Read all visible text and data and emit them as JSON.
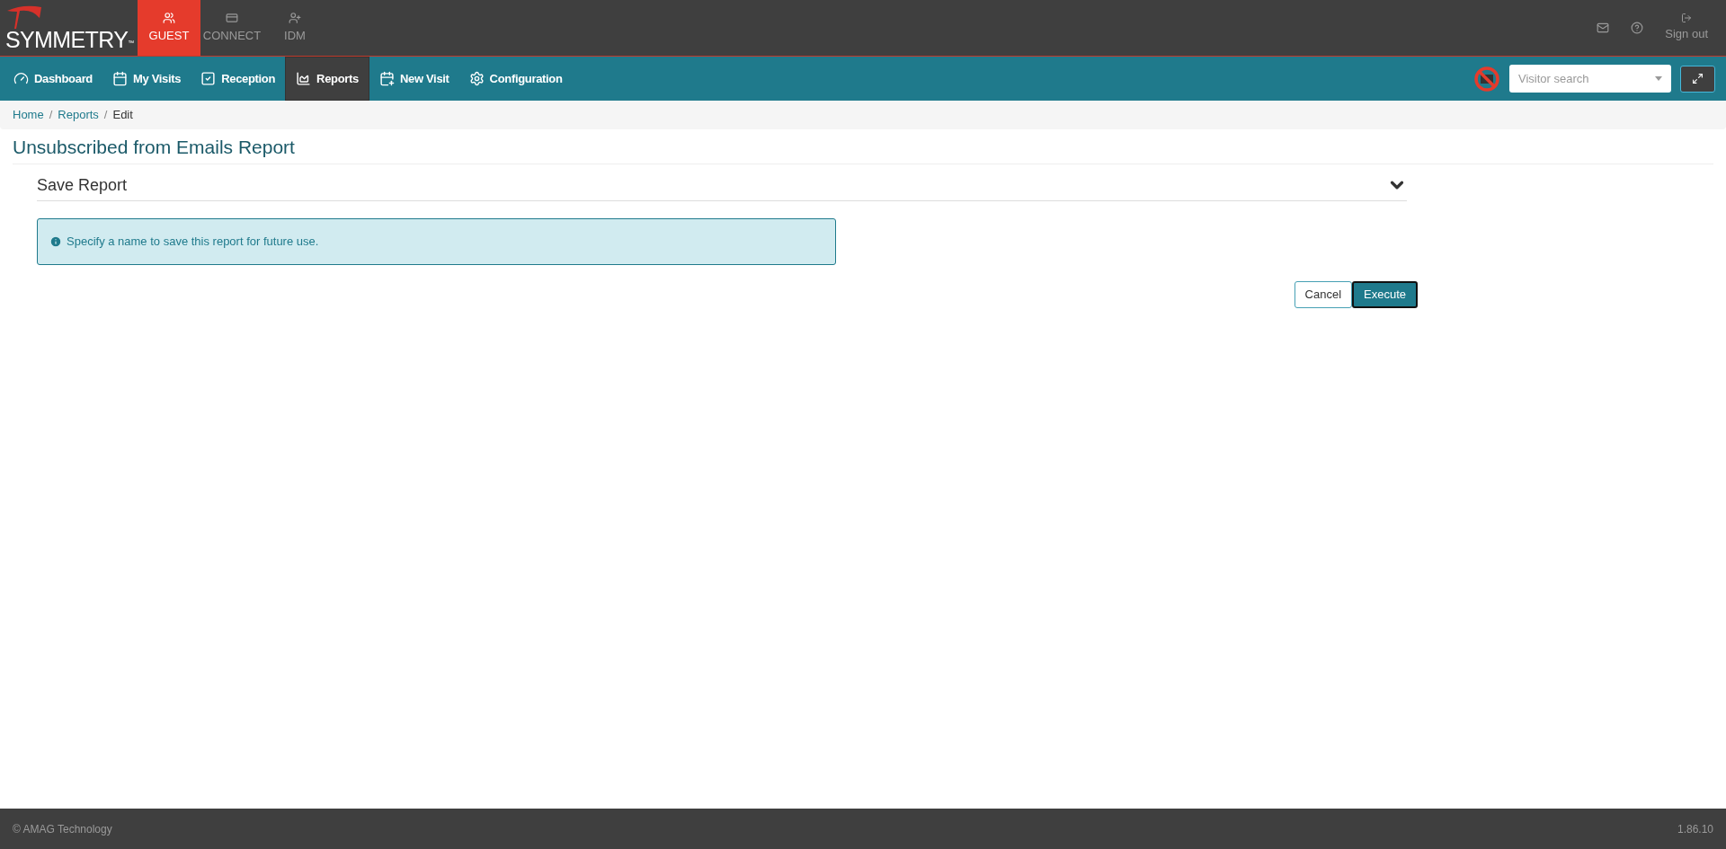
{
  "logo": {
    "text": "SYMMETRY",
    "mark": "™"
  },
  "apps": [
    {
      "label": "GUEST",
      "kind": "guest",
      "selected": true
    },
    {
      "label": "CONNECT",
      "kind": "connect",
      "selected": false
    },
    {
      "label": "IDM",
      "kind": "idm",
      "selected": false
    }
  ],
  "header_actions": {
    "sign_out": "Sign out"
  },
  "nav": [
    {
      "label": "Dashboard",
      "kind": "dashboard",
      "selected": false
    },
    {
      "label": "My Visits",
      "kind": "visits",
      "selected": false
    },
    {
      "label": "Reception",
      "kind": "reception",
      "selected": false
    },
    {
      "label": "Reports",
      "kind": "reports",
      "selected": true
    },
    {
      "label": "New Visit",
      "kind": "newvisit",
      "selected": false
    },
    {
      "label": "Configuration",
      "kind": "config",
      "selected": false
    }
  ],
  "visitor_search": {
    "placeholder": "Visitor search"
  },
  "breadcrumb": [
    {
      "label": "Home",
      "link": true
    },
    {
      "separator": "/",
      "label": "Reports",
      "link": true
    },
    {
      "separator": "/",
      "label": "Edit",
      "link": false
    }
  ],
  "page_title": "Unsubscribed from Emails Report",
  "section": {
    "title": "Save Report",
    "expanded": true
  },
  "info": "Specify a name to save this report for future use.",
  "buttons": [
    {
      "label": "Cancel",
      "kind": "secondary"
    },
    {
      "label": "Execute",
      "kind": "primary"
    }
  ],
  "footer": {
    "copyright": "© AMAG Technology",
    "version": "1.86.10"
  }
}
